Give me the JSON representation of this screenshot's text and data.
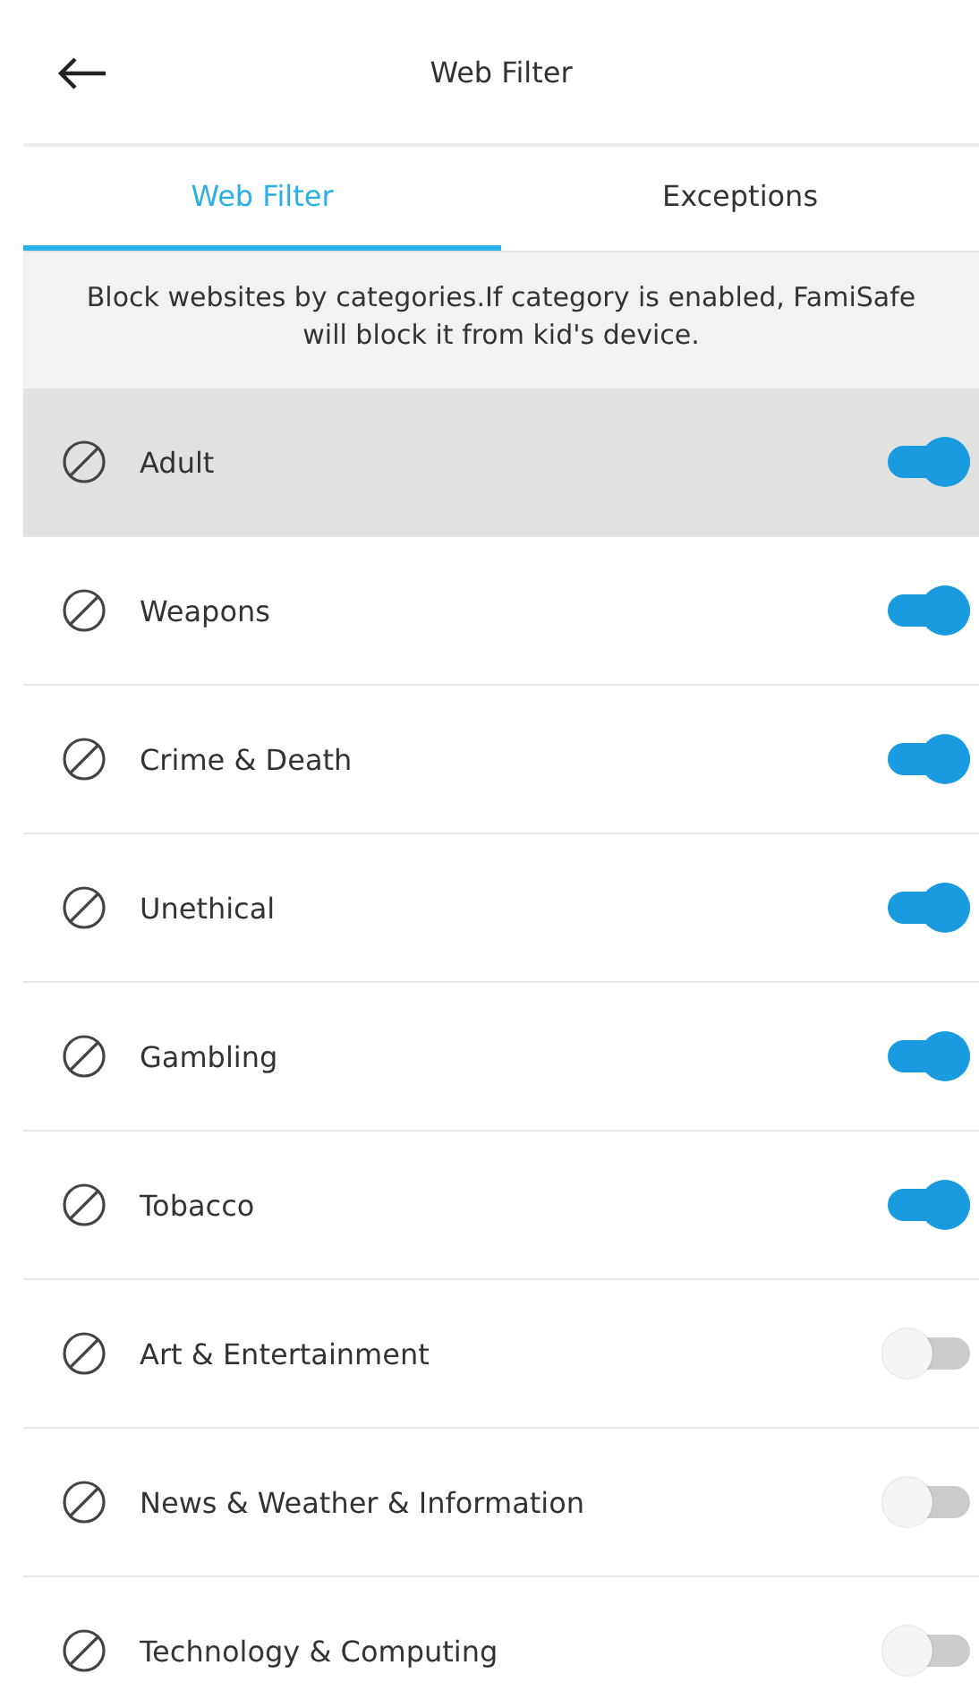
{
  "header": {
    "title": "Web Filter"
  },
  "tabs": [
    {
      "label": "Web Filter",
      "selected": true
    },
    {
      "label": "Exceptions",
      "selected": false
    }
  ],
  "notice": "Block websites by categories.If category is enabled, FamiSafe will block it from kid's device.",
  "categories": [
    {
      "name": "Adult",
      "enabled": true,
      "selected": true
    },
    {
      "name": "Weapons",
      "enabled": true,
      "selected": false
    },
    {
      "name": "Crime & Death",
      "enabled": true,
      "selected": false
    },
    {
      "name": "Unethical",
      "enabled": true,
      "selected": false
    },
    {
      "name": "Gambling",
      "enabled": true,
      "selected": false
    },
    {
      "name": "Tobacco",
      "enabled": true,
      "selected": false
    },
    {
      "name": "Art & Entertainment",
      "enabled": false,
      "selected": false
    },
    {
      "name": "News & Weather & Information",
      "enabled": false,
      "selected": false
    },
    {
      "name": "Technology & Computing",
      "enabled": false,
      "selected": false
    }
  ]
}
